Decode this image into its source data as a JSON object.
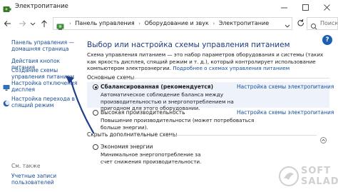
{
  "window": {
    "title": "Электропитание",
    "icons": {
      "app": "power-options-icon",
      "minimize": "minimize-icon",
      "maximize": "maximize-icon",
      "close": "close-icon"
    }
  },
  "navbar": {
    "icons": {
      "back": "back-arrow-icon",
      "forward": "forward-arrow-icon",
      "recent": "chevron-down-icon",
      "up": "up-arrow-icon",
      "refresh": "refresh-icon"
    },
    "breadcrumbs": [
      "Панель управления",
      "Оборудование и звук",
      "Электропитание"
    ],
    "search_placeholder": "Поиск в п"
  },
  "sidebar": {
    "home_link": "Панель управления — домашняя страница",
    "items": [
      {
        "label": "Действия кнопок питания"
      },
      {
        "label": "Создание схемы управления питанием"
      },
      {
        "label": "Настройка отключения дисплея",
        "icon": "display-icon"
      },
      {
        "label": "Настройка перехода в спящий режим",
        "icon": "moon-icon"
      }
    ],
    "see_also": "См. также",
    "user_accounts": "Учетные записи пользователей"
  },
  "main": {
    "title": "Выбор или настройка схемы управления питанием",
    "description_prefix": "Схема управления питанием — это набор параметров оборудования и системы (таких как яркость дисплея, спящий режим и т. д.), который контролирует использование компьютером электроэнергии. ",
    "description_link": "Подробнее о схемах управления питанием",
    "basic_plans_label": "Основные схемы",
    "plans": [
      {
        "name": "Сбалансированная (рекомендуется)",
        "selected": true,
        "description": "Автоматическое соблюдение баланса между производительностью и энергопотреблением на пригодном для этого оборудовании.",
        "settings_link": "Настройка схемы электропитания"
      },
      {
        "name": "Высокая производительность",
        "selected": false,
        "description": "Повышение производительности (может потребоваться больше энергии).",
        "settings_link": "Настройка схемы электропитания"
      }
    ],
    "extra_plans_label": "Скрыть дополнительные схемы",
    "extra_plans": [
      {
        "name": "Экономия энергии",
        "selected": false,
        "description": "Минимальное энергопотребление за счет снижения производительности."
      }
    ],
    "help_label": "?"
  },
  "watermark": {
    "line1": "SOFT",
    "line2": "SALAD",
    "logo": "softsalad-logo-icon"
  },
  "colors": {
    "link": "#1a4f96",
    "title": "#1e3c7a",
    "arrow": "#1f3f8a",
    "selected_bg": "#eef3fb"
  }
}
